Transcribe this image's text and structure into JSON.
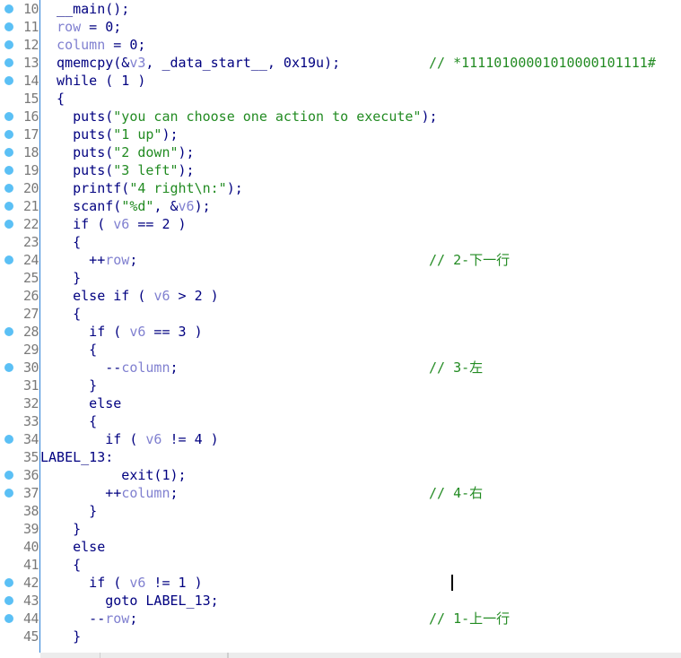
{
  "colors": {
    "keyword": "#000080",
    "variable": "#8080d0",
    "string": "#228b22",
    "comment": "#228b22",
    "breakpoint": "#5bc0f5"
  },
  "lines": [
    {
      "n": "10",
      "bp": true,
      "tokens": [
        [
          "",
          "  __main();"
        ]
      ]
    },
    {
      "n": "11",
      "bp": true,
      "tokens": [
        [
          "",
          "  "
        ],
        [
          "v",
          "row"
        ],
        [
          "",
          " = 0;"
        ]
      ]
    },
    {
      "n": "12",
      "bp": true,
      "tokens": [
        [
          "",
          "  "
        ],
        [
          "v",
          "column"
        ],
        [
          "",
          " = 0;"
        ]
      ]
    },
    {
      "n": "13",
      "bp": true,
      "tokens": [
        [
          "",
          "  qmemcpy(&"
        ],
        [
          "v",
          "v3"
        ],
        [
          "",
          ", _data_start__, 0x19u);"
        ]
      ],
      "comment": "// *11110100001010000101111#"
    },
    {
      "n": "14",
      "bp": true,
      "tokens": [
        [
          "",
          "  while ( 1 )"
        ]
      ]
    },
    {
      "n": "15",
      "bp": false,
      "tokens": [
        [
          "",
          "  {"
        ]
      ]
    },
    {
      "n": "16",
      "bp": true,
      "tokens": [
        [
          "",
          "    puts("
        ],
        [
          "s",
          "\"you can choose one action to execute\""
        ],
        [
          "",
          ");"
        ]
      ]
    },
    {
      "n": "17",
      "bp": true,
      "tokens": [
        [
          "",
          "    puts("
        ],
        [
          "s",
          "\"1 up\""
        ],
        [
          "",
          ");"
        ]
      ]
    },
    {
      "n": "18",
      "bp": true,
      "tokens": [
        [
          "",
          "    puts("
        ],
        [
          "s",
          "\"2 down\""
        ],
        [
          "",
          ");"
        ]
      ]
    },
    {
      "n": "19",
      "bp": true,
      "tokens": [
        [
          "",
          "    puts("
        ],
        [
          "s",
          "\"3 left\""
        ],
        [
          "",
          ");"
        ]
      ]
    },
    {
      "n": "20",
      "bp": true,
      "tokens": [
        [
          "",
          "    printf("
        ],
        [
          "s",
          "\"4 right\\n:\""
        ],
        [
          "",
          ");"
        ]
      ]
    },
    {
      "n": "21",
      "bp": true,
      "tokens": [
        [
          "",
          "    scanf("
        ],
        [
          "s",
          "\"%d\""
        ],
        [
          "",
          ", &"
        ],
        [
          "v",
          "v6"
        ],
        [
          "",
          ");"
        ]
      ]
    },
    {
      "n": "22",
      "bp": true,
      "tokens": [
        [
          "",
          "    if ( "
        ],
        [
          "v",
          "v6"
        ],
        [
          "",
          " == 2 )"
        ]
      ]
    },
    {
      "n": "23",
      "bp": false,
      "tokens": [
        [
          "",
          "    {"
        ]
      ]
    },
    {
      "n": "24",
      "bp": true,
      "tokens": [
        [
          "",
          "      ++"
        ],
        [
          "v",
          "row"
        ],
        [
          "",
          ";"
        ]
      ],
      "comment": "// 2-下一行"
    },
    {
      "n": "25",
      "bp": false,
      "tokens": [
        [
          "",
          "    }"
        ]
      ]
    },
    {
      "n": "26",
      "bp": false,
      "tokens": [
        [
          "",
          "    else if ( "
        ],
        [
          "v",
          "v6"
        ],
        [
          "",
          " > 2 )"
        ]
      ]
    },
    {
      "n": "27",
      "bp": false,
      "tokens": [
        [
          "",
          "    {"
        ]
      ]
    },
    {
      "n": "28",
      "bp": true,
      "tokens": [
        [
          "",
          "      if ( "
        ],
        [
          "v",
          "v6"
        ],
        [
          "",
          " == 3 )"
        ]
      ]
    },
    {
      "n": "29",
      "bp": false,
      "tokens": [
        [
          "",
          "      {"
        ]
      ]
    },
    {
      "n": "30",
      "bp": true,
      "tokens": [
        [
          "",
          "        --"
        ],
        [
          "v",
          "column"
        ],
        [
          "",
          ";"
        ]
      ],
      "comment": "// 3-左"
    },
    {
      "n": "31",
      "bp": false,
      "tokens": [
        [
          "",
          "      }"
        ]
      ]
    },
    {
      "n": "32",
      "bp": false,
      "tokens": [
        [
          "",
          "      else"
        ]
      ]
    },
    {
      "n": "33",
      "bp": false,
      "tokens": [
        [
          "",
          "      {"
        ]
      ]
    },
    {
      "n": "34",
      "bp": true,
      "tokens": [
        [
          "",
          "        if ( "
        ],
        [
          "v",
          "v6"
        ],
        [
          "",
          " != 4 )"
        ]
      ]
    },
    {
      "n": "35",
      "bp": false,
      "tokens": [
        [
          "",
          "LABEL_13:"
        ]
      ]
    },
    {
      "n": "36",
      "bp": true,
      "tokens": [
        [
          "",
          "          exit(1);"
        ]
      ]
    },
    {
      "n": "37",
      "bp": true,
      "tokens": [
        [
          "",
          "        ++"
        ],
        [
          "v",
          "column"
        ],
        [
          "",
          ";"
        ]
      ],
      "comment": "// 4-右"
    },
    {
      "n": "38",
      "bp": false,
      "tokens": [
        [
          "",
          "      }"
        ]
      ]
    },
    {
      "n": "39",
      "bp": false,
      "tokens": [
        [
          "",
          "    }"
        ]
      ]
    },
    {
      "n": "40",
      "bp": false,
      "tokens": [
        [
          "",
          "    else"
        ]
      ]
    },
    {
      "n": "41",
      "bp": false,
      "tokens": [
        [
          "",
          "    {"
        ]
      ]
    },
    {
      "n": "42",
      "bp": true,
      "tokens": [
        [
          "",
          "      if ( "
        ],
        [
          "v",
          "v6"
        ],
        [
          "",
          " != 1 )"
        ]
      ]
    },
    {
      "n": "43",
      "bp": true,
      "tokens": [
        [
          "",
          "        goto LABEL_13;"
        ]
      ]
    },
    {
      "n": "44",
      "bp": true,
      "tokens": [
        [
          "",
          "      --"
        ],
        [
          "v",
          "row"
        ],
        [
          "",
          ";"
        ]
      ],
      "comment": "// 1-上一行"
    },
    {
      "n": "45",
      "bp": false,
      "tokens": [
        [
          "",
          "    }"
        ]
      ]
    }
  ]
}
